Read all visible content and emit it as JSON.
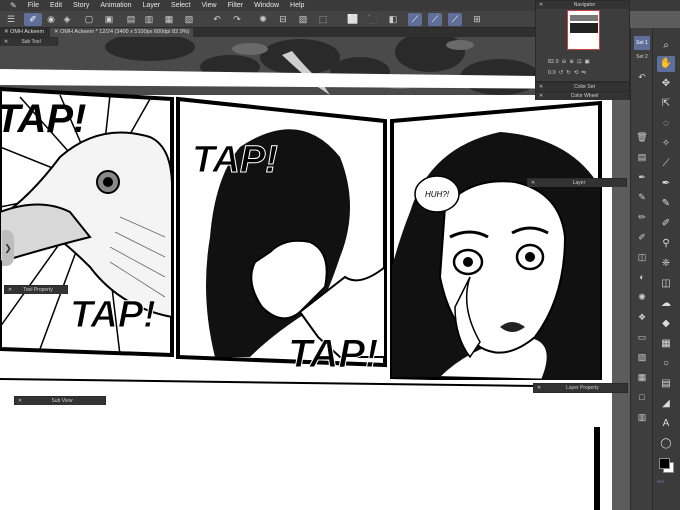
{
  "app": {
    "menu": [
      "File",
      "Edit",
      "Story",
      "Animation",
      "Layer",
      "Select",
      "View",
      "Filter",
      "Window",
      "Help"
    ]
  },
  "tabs": [
    {
      "label": "OMH Ackeem"
    },
    {
      "label": "OMH Ackeem * 12/24 (3400 x 5100px 600dpi 82.9%)"
    }
  ],
  "palettes": {
    "sub_tool": "Sub Tool",
    "tool_property": "Tool Property",
    "sub_view": "Sub View",
    "navigator": "Navigator",
    "color_set": "Color Set",
    "color_wheel": "Color Wheel",
    "layer": "Layer",
    "layer_property": "Layer Property"
  },
  "navigator": {
    "zoom": "82.9",
    "rotation": "0.0"
  },
  "sets": [
    "Set 1",
    "Set 2"
  ],
  "comic": {
    "sfx_tap": "TAP!",
    "speech_huh": "HUH?!"
  },
  "colors": {
    "accent": "#5f6f9a",
    "panel_bg": "#3d3d3d",
    "menubar_bg": "#3a3a3a"
  }
}
